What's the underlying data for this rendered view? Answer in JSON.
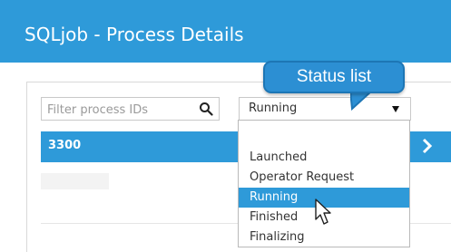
{
  "window": {
    "title": "SQLjob - Process Details"
  },
  "filter": {
    "placeholder": "Filter process IDs",
    "value": "",
    "icon": "search-icon"
  },
  "status_select": {
    "selected_value": "Running",
    "options": [
      "",
      "Launched",
      "Operator Request",
      "Running",
      "Finished",
      "Finalizing"
    ],
    "highlighted_option": "Running"
  },
  "process_list": {
    "rows": [
      {
        "id": "3300",
        "selected": true
      }
    ]
  },
  "callout": {
    "text": "Status list"
  },
  "colors": {
    "accent": "#2e9ad9",
    "callout": "#2c8fd3",
    "callout_border": "#1d76b5",
    "text": "#333333"
  }
}
